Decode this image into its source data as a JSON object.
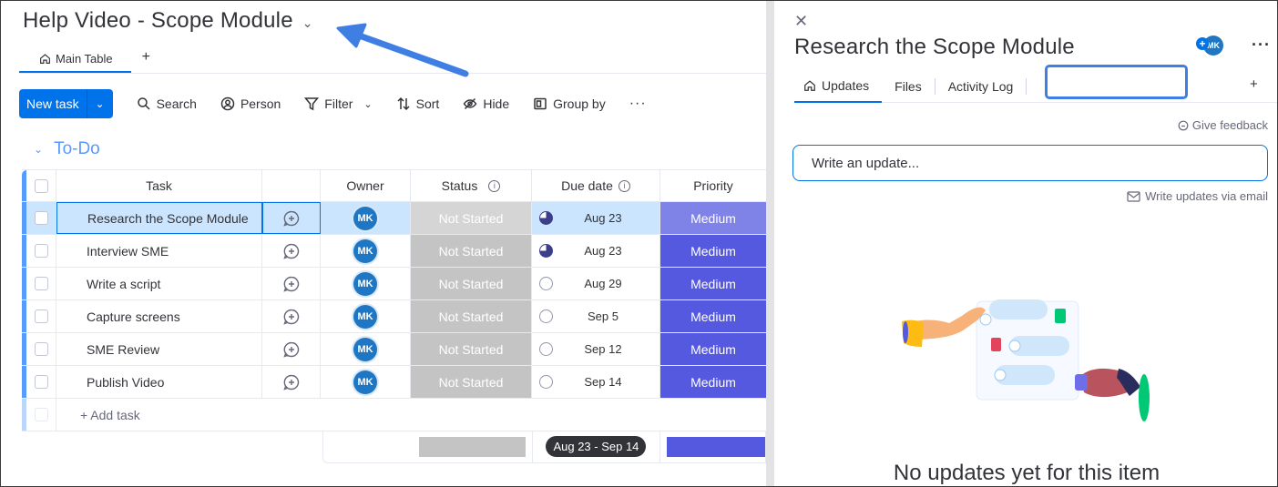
{
  "board": {
    "title": "Help Video - Scope Module",
    "title_chevron": "⌄",
    "views": [
      {
        "label": "Main Table"
      }
    ],
    "add_view": "+"
  },
  "toolbar": {
    "new_task": "New task",
    "search": "Search",
    "person": "Person",
    "filter": "Filter",
    "sort": "Sort",
    "hide": "Hide",
    "group_by": "Group by",
    "more": "···"
  },
  "group": {
    "name": "To-Do",
    "color": "#579bfc",
    "columns": {
      "task": "Task",
      "owner": "Owner",
      "status": "Status",
      "due": "Due date",
      "priority": "Priority"
    },
    "rows": [
      {
        "task": "Research the Scope Module",
        "owner": "MK",
        "status": "Not Started",
        "due": "Aug 23",
        "priority": "Medium"
      },
      {
        "task": "Interview SME",
        "owner": "MK",
        "status": "Not Started",
        "due": "Aug 23",
        "priority": "Medium"
      },
      {
        "task": "Write a script",
        "owner": "MK",
        "status": "Not Started",
        "due": "Aug 29",
        "priority": "Medium"
      },
      {
        "task": "Capture screens",
        "owner": "MK",
        "status": "Not Started",
        "due": "Sep 5",
        "priority": "Medium"
      },
      {
        "task": "SME Review",
        "owner": "MK",
        "status": "Not Started",
        "due": "Sep 12",
        "priority": "Medium"
      },
      {
        "task": "Publish Video",
        "owner": "MK",
        "status": "Not Started",
        "due": "Sep 14",
        "priority": "Medium"
      }
    ],
    "add_task": "+ Add task",
    "summary_due": "Aug 23 - Sep 14"
  },
  "colors": {
    "accent": "#0073ea",
    "status_not_started": "#c4c4c4",
    "priority_medium": "#5559df",
    "annotation": "#3f7fe3"
  },
  "panel": {
    "close": "✕",
    "title": "Research the Scope Module",
    "subscriber": "MK",
    "subscribe_plus": "+",
    "more": "···",
    "tabs": [
      {
        "label": "Updates"
      },
      {
        "label": "Files"
      },
      {
        "label": "Activity Log"
      }
    ],
    "add_tab": "+",
    "give_feedback": "Give feedback",
    "update_placeholder": "Write an update...",
    "write_via_email": "Write updates via email",
    "empty_title": "No updates yet for this item"
  }
}
